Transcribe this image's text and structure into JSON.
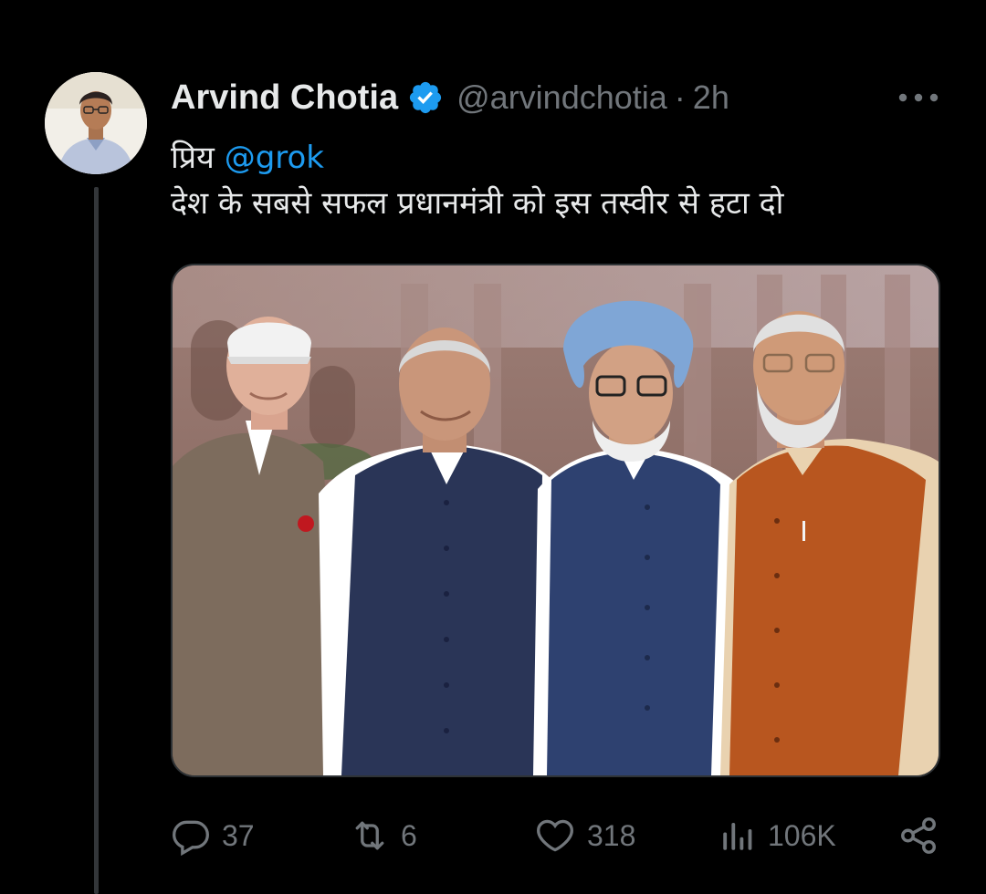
{
  "tweet": {
    "author_name": "Arvind Chotia",
    "author_handle": "@arvindchotia",
    "separator": "·",
    "time": "2h",
    "greeting": "प्रिय",
    "mention": "@grok",
    "body_line": "देश के सबसे सफल प्रधानमंत्री को इस तस्वीर से हटा दो"
  },
  "actions": {
    "replies": "37",
    "reposts": "6",
    "likes": "318",
    "views": "106K"
  },
  "icons": {
    "verified": "verified-badge-icon",
    "more": "more-horizontal-icon",
    "reply": "reply-icon",
    "repost": "repost-icon",
    "like": "heart-icon",
    "views": "views-chart-icon",
    "share": "share-icon"
  },
  "colors": {
    "background": "#000000",
    "text": "#e7e9ea",
    "secondary": "#71767b",
    "accent": "#1d9bf0"
  }
}
